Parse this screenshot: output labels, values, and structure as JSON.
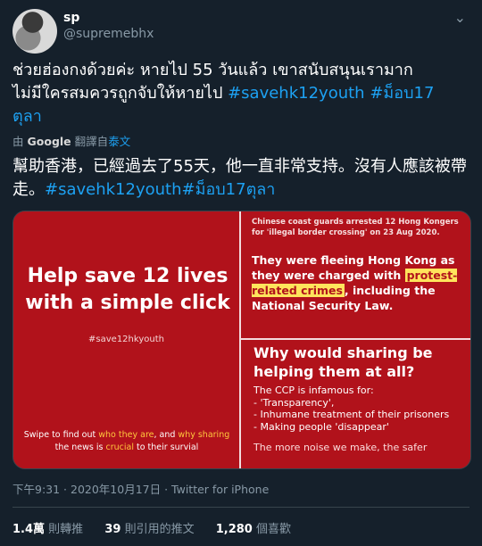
{
  "user": {
    "display_name": "sp",
    "handle": "@supremebhx"
  },
  "tweet": {
    "text_line1": "ช่วยฮ่องกงด้วยค่ะ หายไป 55 วันแล้ว เขาสนับสนุนเรามาก",
    "text_line2_plain": "ไม่มีใครสมควรถูกจับให้หายไป ",
    "hashtag1": "#savehk12youth",
    "hashtag2": " #ม็อบ17",
    "text_line3": "ตุลา"
  },
  "translation": {
    "by_prefix": "由",
    "provider": "Google",
    "suffix": "翻譯自",
    "language": "泰文",
    "text_plain": "幫助香港，已經過去了55天，他一直非常支持。沒有人應該被帶走。",
    "hashtag": "#savehk12youth#ม็อบ17ตุลา"
  },
  "media": {
    "panel1": {
      "headline": "Help save 12 lives with a simple click",
      "hashtag": "#save12hkyouth",
      "swipe_a": "Swipe to find out ",
      "swipe_b": "who they are",
      "swipe_c": ", and ",
      "swipe_d": "why sharing",
      "swipe_e": " the news is ",
      "swipe_f": "crucial",
      "swipe_g": " to their survial"
    },
    "panel2": {
      "small": "Chinese coast guards arrested 12 Hong Kongers for 'illegal border crossing' on 23 Aug 2020.",
      "body_a": "They were fleeing Hong Kong as they were charged with ",
      "body_hl": "protest-related crimes",
      "body_b": ", including the National Security Law."
    },
    "panel3": {
      "heading": "Why would sharing be helping them at all?",
      "intro": "The CCP is infamous for:",
      "item1": "- 'Transparency',",
      "item2": "- Inhumane treatment of their prisoners",
      "item3": "- Making people 'disappear'",
      "more": "The more noise we make, the safer"
    }
  },
  "meta": {
    "time": "下午9:31",
    "date": "2020年10月17日",
    "source": "Twitter for iPhone"
  },
  "stats": {
    "retweets": "1.4萬",
    "retweets_label": "則轉推",
    "quotes": "39",
    "quotes_label": "則引用的推文",
    "likes": "1,280",
    "likes_label": "個喜歡"
  },
  "icons": {
    "more": "chevron-down-icon"
  },
  "colors": {
    "bg": "#15202b",
    "link": "#1da1f2",
    "muted": "#8899a6",
    "red": "#b1121b"
  }
}
